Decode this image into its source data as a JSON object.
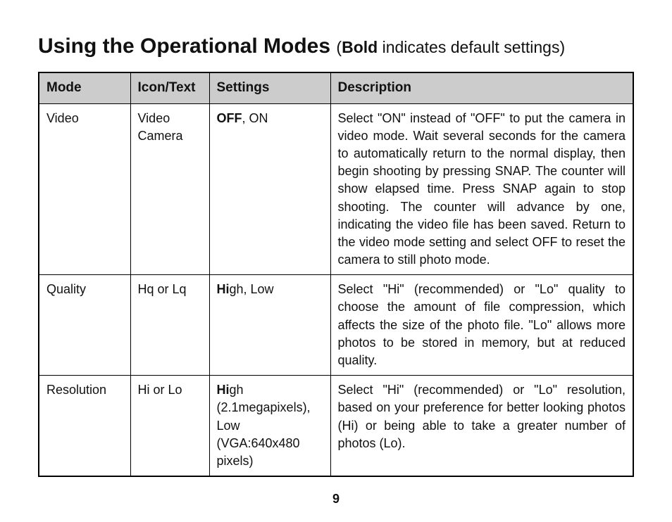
{
  "title": {
    "main": "Using the Operational Modes",
    "note_open": "(",
    "note_bold": "Bold",
    "note_rest": " indicates default settings)"
  },
  "table": {
    "headers": {
      "mode": "Mode",
      "icon": "Icon/Text",
      "settings": "Settings",
      "description": "Description"
    },
    "rows": [
      {
        "mode": "Video",
        "icon": "Video Camera",
        "settings_bold": "OFF",
        "settings_rest": ", ON",
        "description": "Select \"ON\" instead of \"OFF\" to put the camera in video mode. Wait several seconds for the camera to automatically return to the normal display, then begin shooting by pressing SNAP. The counter will show elapsed time. Press SNAP again to stop shooting. The counter will advance by one, indicating the video file has been saved. Return to the video mode setting and select OFF to reset the camera to still photo mode."
      },
      {
        "mode": "Quality",
        "icon": "Hq or Lq",
        "settings_bold": "Hi",
        "settings_rest": "gh, Low",
        "description": "Select \"Hi\" (recommended) or \"Lo\" quality to choose the amount of file compression, which affects the size of the photo file. \"Lo\" allows more photos to be stored in memory, but at reduced quality."
      },
      {
        "mode": "Resolution",
        "icon": "Hi or Lo",
        "settings_bold": "Hi",
        "settings_rest": "gh (2.1megapixels), Low (VGA:640x480 pixels)",
        "description": "Select \"Hi\" (recommended) or \"Lo\" resolution, based on your preference for better looking photos (Hi) or being able to take a greater number of photos (Lo)."
      }
    ]
  },
  "page_number": "9"
}
